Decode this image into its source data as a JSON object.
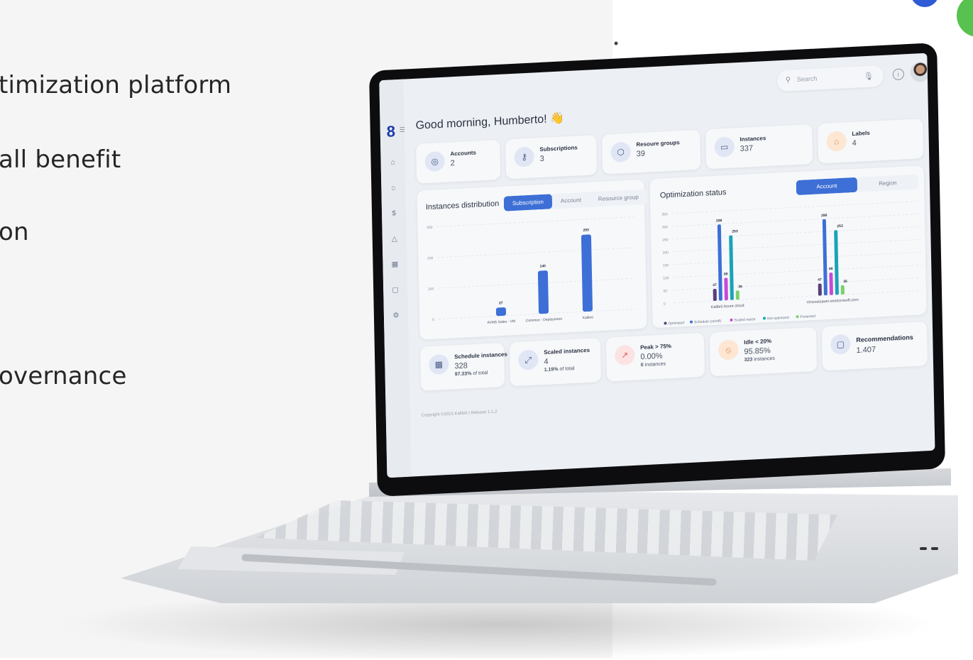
{
  "slide": {
    "bullets": [
      "timization platform",
      "all benefit",
      "on",
      "overnance"
    ]
  },
  "app": {
    "greeting": "Good morning, Humberto! 👋",
    "search_placeholder": "Search",
    "stats": [
      {
        "title": "Accounts",
        "value": "2"
      },
      {
        "title": "Subscriptions",
        "value": "3"
      },
      {
        "title": "Resoure groups",
        "value": "39"
      },
      {
        "title": "Instances",
        "value": "337"
      },
      {
        "title": "Labels",
        "value": "4"
      }
    ],
    "instances_panel": {
      "title": "Instances distribution",
      "tabs": [
        "Subscription",
        "Account",
        "Resource group"
      ]
    },
    "optimization_panel": {
      "title": "Optimization status",
      "tabs": [
        "Account",
        "Region"
      ]
    },
    "bottom_cards": [
      {
        "title": "Schedule instances",
        "value": "328",
        "sub_bold": "97.33%",
        "sub": "of total"
      },
      {
        "title": "Scaled instances",
        "value": "4",
        "sub_bold": "1.19%",
        "sub": "of total"
      },
      {
        "title": "Peak > 75%",
        "value": "0.00%",
        "sub_bold": "0",
        "sub": "instances"
      },
      {
        "title": "Idle < 20%",
        "value": "95.85%",
        "sub_bold": "323",
        "sub": "instances"
      },
      {
        "title": "Recommendations",
        "value": "1.407"
      }
    ],
    "footer": "Copyright ©2023 Kalibrii | Release 1.1.2",
    "colors": {
      "accent": "#3d6fd6",
      "optimized": "#5a3f7a",
      "schedule": "#3d6fd6",
      "scaled": "#c54ad6",
      "not_optimized": "#1aa3b8",
      "protected": "#7bd06b"
    }
  },
  "chart_data": [
    {
      "type": "bar",
      "title": "Instances distribution",
      "categories": [
        "AVMS Sales - VM",
        "Common - Deployment",
        "Kalibrii"
      ],
      "values": [
        27,
        140,
        250
      ],
      "y_ticks": [
        0,
        100,
        200,
        300
      ],
      "ylim": [
        0,
        300
      ],
      "grid": true
    },
    {
      "type": "bar",
      "title": "Optimization status",
      "categories": [
        "Kalibrii Azure cloud",
        "Vmcostsaver.onmicrosoft.com"
      ],
      "series": [
        {
          "name": "Optimized",
          "values": [
            47,
            47
          ]
        },
        {
          "name": "Schedule (on/off)",
          "values": [
            298,
            298
          ]
        },
        {
          "name": "Scaled resize",
          "values": [
            88,
            88
          ]
        },
        {
          "name": "Not optimized",
          "values": [
            253,
            253
          ]
        },
        {
          "name": "Protected",
          "values": [
            36,
            36
          ]
        }
      ],
      "y_ticks": [
        0,
        50,
        100,
        150,
        200,
        250,
        300,
        350
      ],
      "ylim": [
        0,
        350
      ],
      "legend": "bottom",
      "grid": true
    }
  ]
}
